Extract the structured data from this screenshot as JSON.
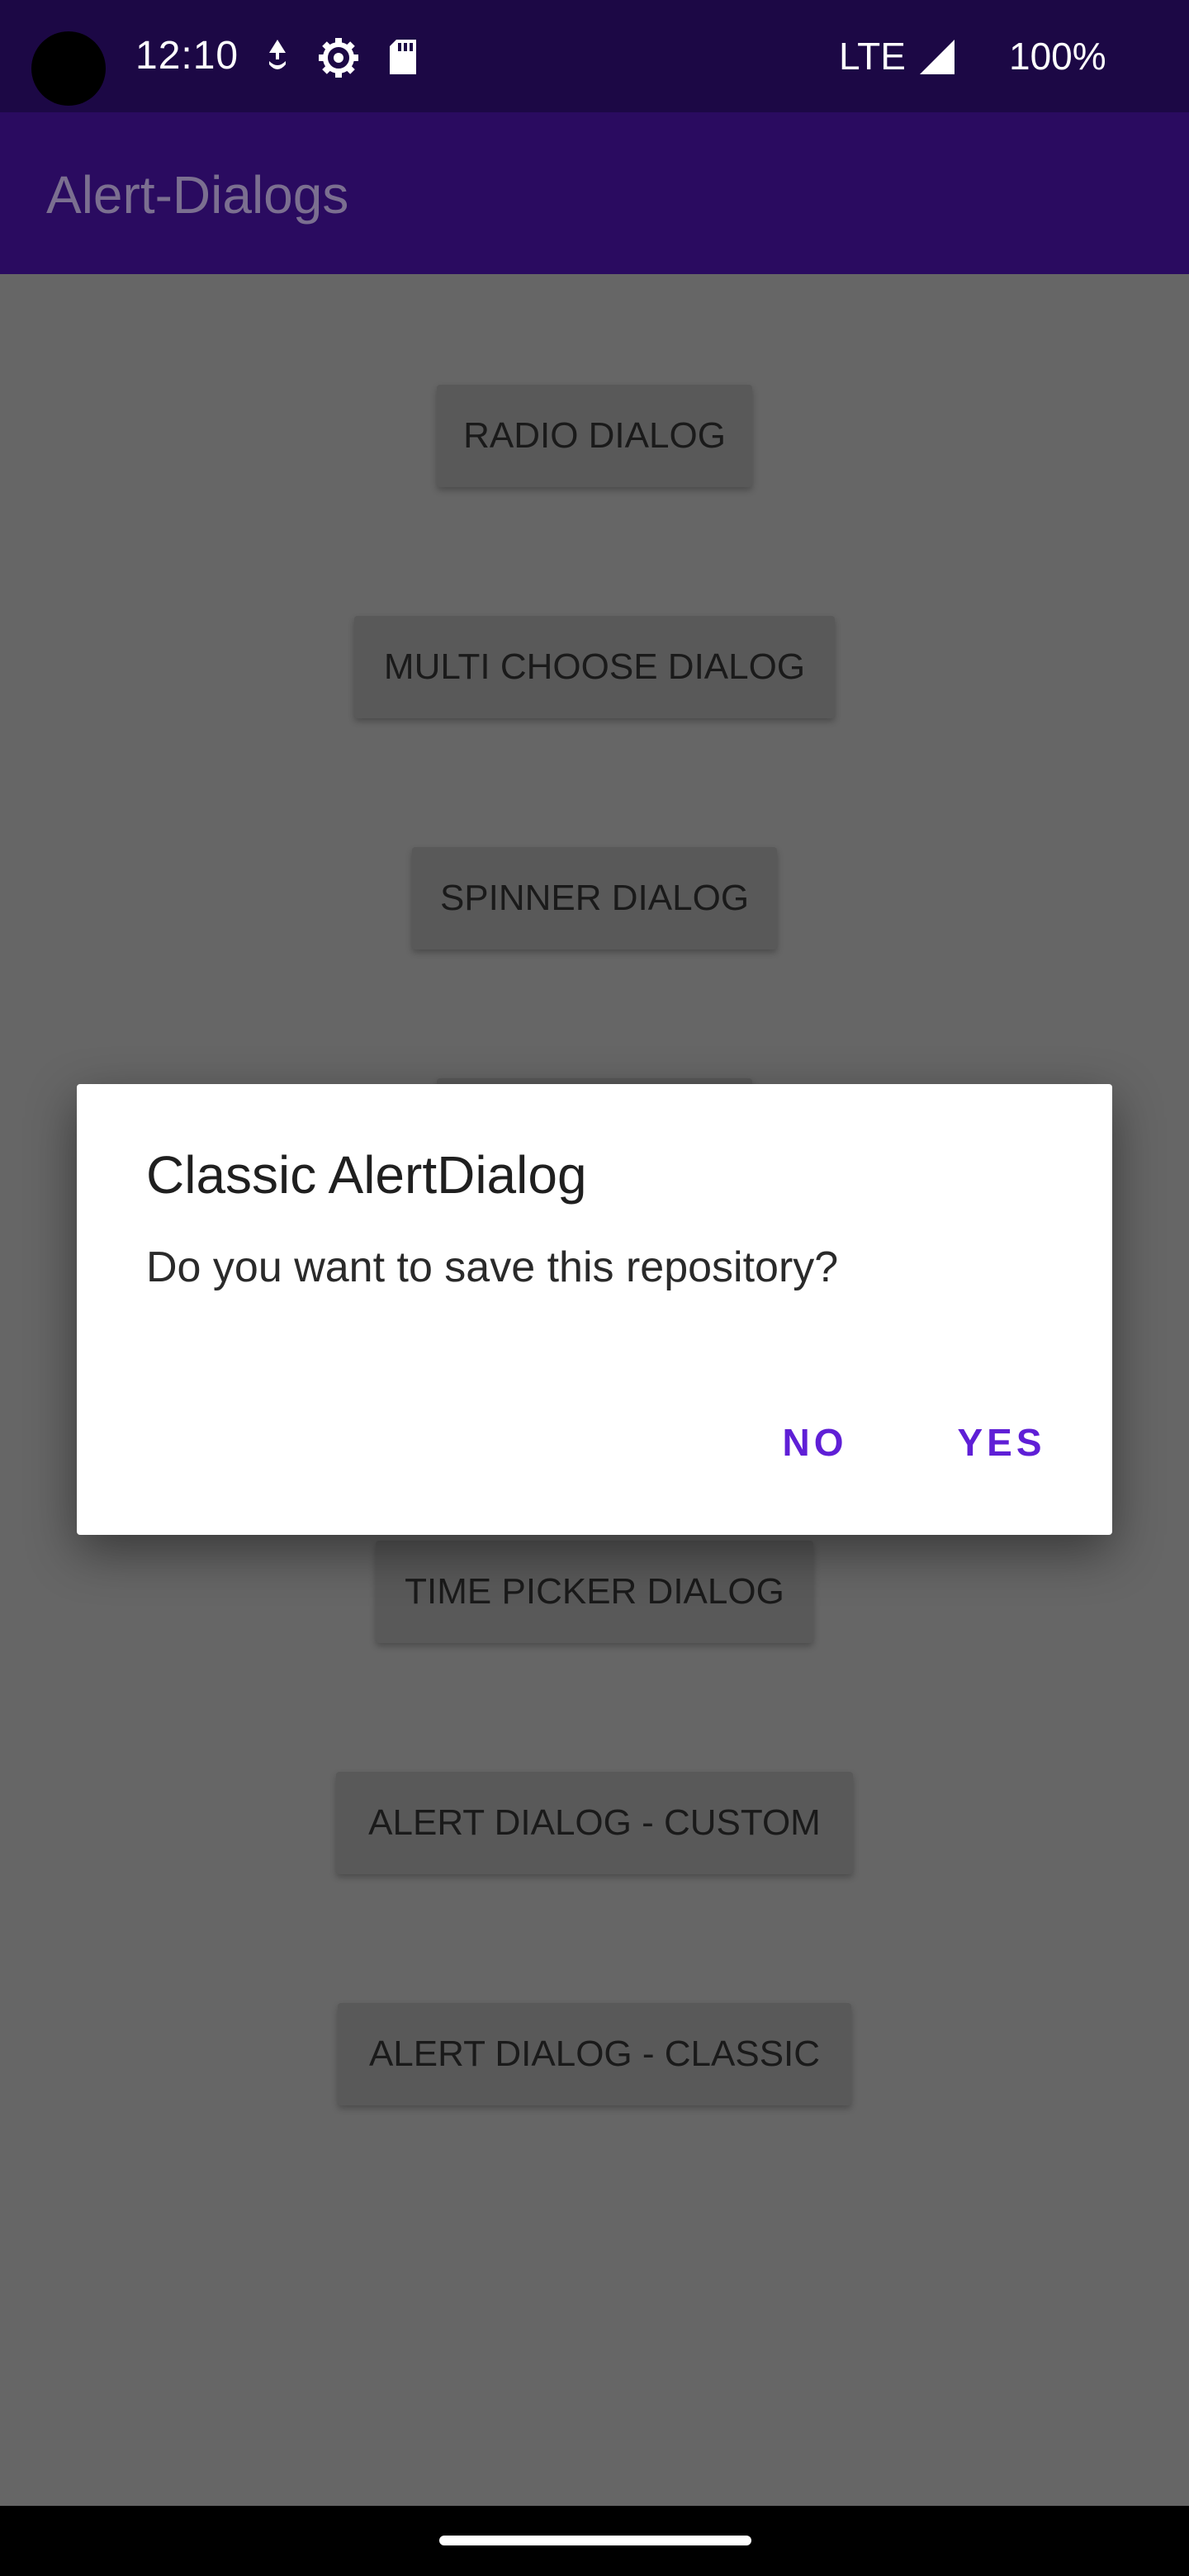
{
  "status_bar": {
    "time": "12:10",
    "network": "LTE",
    "battery": "100%",
    "icons": [
      "data-saver-icon",
      "settings-gear-icon",
      "sd-card-icon",
      "signal-icon"
    ]
  },
  "app_bar": {
    "title": "Alert-Dialogs"
  },
  "buttons": {
    "radio_dialog": "RADIO DIALOG",
    "multi_choose_dialog": "MULTI CHOOSE DIALOG",
    "spinner_dialog": "SPINNER DIALOG",
    "time_picker_dialog": "TIME PICKER DIALOG",
    "alert_dialog_custom": "ALERT DIALOG - CUSTOM",
    "alert_dialog_classic": "ALERT DIALOG - CLASSIC"
  },
  "dialog": {
    "title": "Classic AlertDialog",
    "message": "Do you want to save this repository?",
    "negative_label": "NO",
    "positive_label": "YES"
  },
  "colors": {
    "status_bar": "#1c0845",
    "app_bar": "#2a0b60",
    "scrim_background": "#666666",
    "dialog_accent": "#5f1fd6"
  }
}
